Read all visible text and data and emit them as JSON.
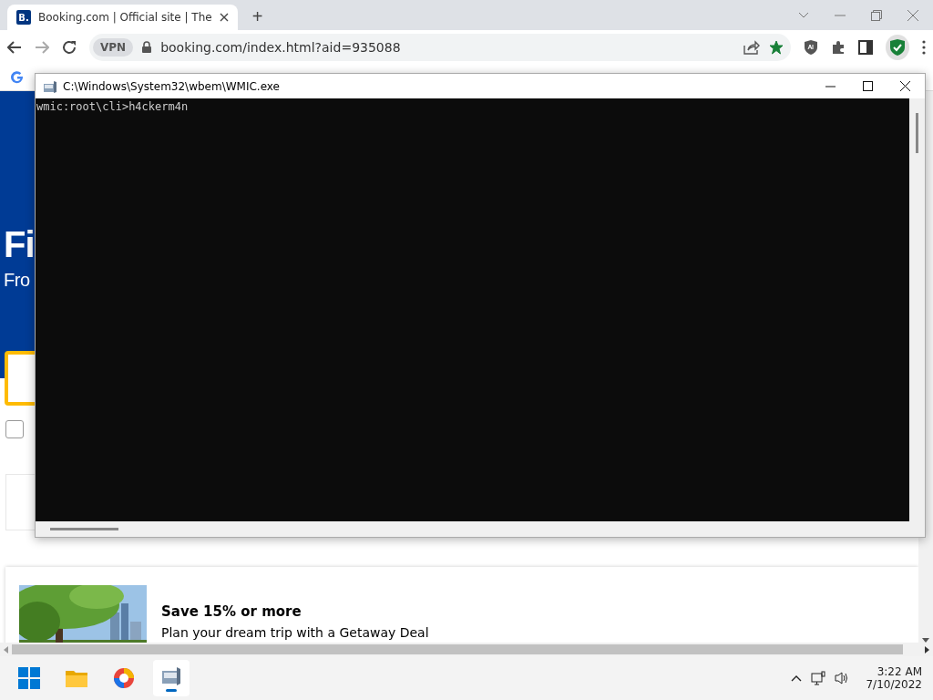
{
  "browser": {
    "tab": {
      "favicon": "B.",
      "title": "Booking.com | Official site | The",
      "selected": true
    },
    "new_tab": "+",
    "address": {
      "vpn": "VPN",
      "url": "booking.com/index.html?aid=935088",
      "bookmarked": true
    }
  },
  "page": {
    "hero": {
      "heading": "Fi",
      "subheading": "Fro"
    },
    "checkbox": {
      "checked": false
    },
    "deal": {
      "kind": "picture",
      "title": "Save 15% or more",
      "text": "Plan your dream trip with a Getaway Deal"
    }
  },
  "console_window": {
    "title": "C:\\Windows\\System32\\wbem\\WMIC.exe",
    "lines": [
      "wmic:root\\cli>h4ckerm4n"
    ]
  },
  "taskbar": {
    "apps": [
      {
        "kind": "start",
        "active": false
      },
      {
        "kind": "folder",
        "active": false
      },
      {
        "kind": "browser",
        "active": false
      },
      {
        "kind": "console",
        "active": true
      }
    ],
    "time": "3:22 AM",
    "date": "7/10/2022"
  }
}
